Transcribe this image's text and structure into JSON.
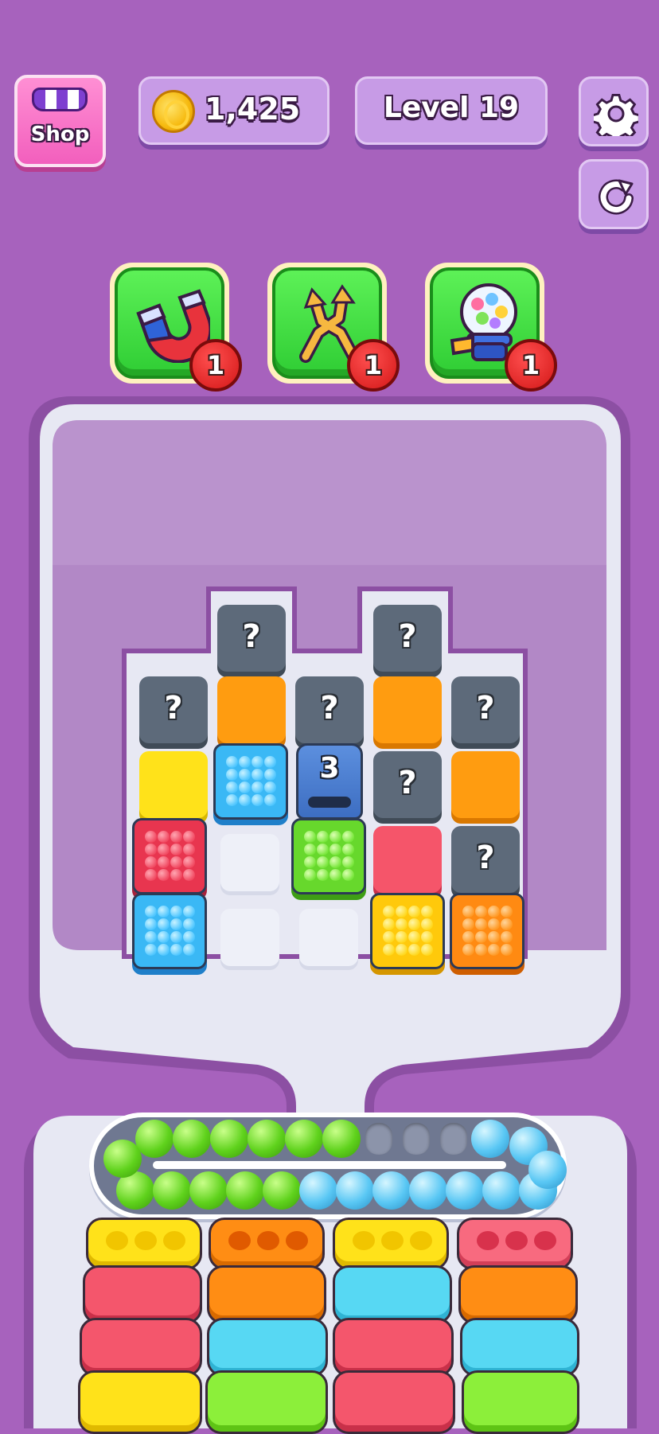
{
  "header": {
    "shop_label": "Shop",
    "coins": "1,425",
    "level": "Level 19"
  },
  "icons": {
    "shop": "shop-stall-icon",
    "coin": "coin-icon",
    "settings": "gear-icon",
    "restart": "restart-icon"
  },
  "boosters": [
    {
      "name": "magnet",
      "icon": "magnet-icon",
      "count": "1"
    },
    {
      "name": "shuffle",
      "icon": "shuffle-arrows-icon",
      "count": "1"
    },
    {
      "name": "gumball",
      "icon": "gumball-machine-icon",
      "count": "1"
    }
  ],
  "board": {
    "dispenser_count": "3",
    "hidden_mark": "?"
  },
  "conveyor": {
    "top_row": [
      "green",
      "green",
      "green",
      "green",
      "green",
      "green",
      "empty",
      "empty",
      "empty",
      "blue"
    ],
    "bottom_row": [
      "green",
      "green",
      "green",
      "green",
      "green",
      "blue",
      "blue",
      "blue",
      "blue",
      "blue",
      "blue",
      "blue"
    ]
  },
  "colors": {
    "background": "#a762bd",
    "booster_green": "#2fcd34",
    "badge_red": "#d31717"
  }
}
